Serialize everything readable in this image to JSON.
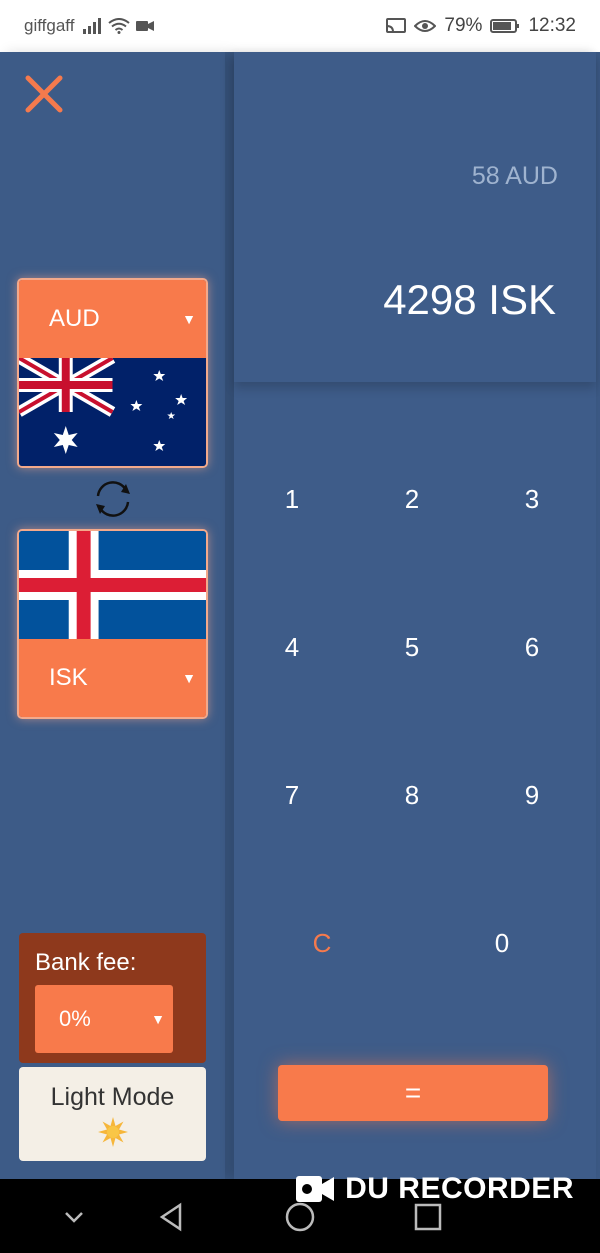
{
  "status_bar": {
    "carrier": "giffgaff",
    "battery": "79%",
    "time": "12:32"
  },
  "converter": {
    "from_currency": "AUD",
    "to_currency": "ISK",
    "input_display": "58 AUD",
    "result_display": "4298 ISK"
  },
  "keypad": {
    "keys": [
      "1",
      "2",
      "3",
      "4",
      "5",
      "6",
      "7",
      "8",
      "9",
      "C",
      "0"
    ],
    "equals_label": "="
  },
  "bank_fee": {
    "label": "Bank fee:",
    "value": "0%"
  },
  "mode_toggle": {
    "label": "Light Mode"
  },
  "watermark": {
    "text": "DU RECORDER"
  },
  "colors": {
    "accent": "#f87a4b",
    "background": "#3c5a86",
    "fee_background": "#8e391c",
    "clear_key": "#f57a4d"
  },
  "icons": {
    "close": "close-icon",
    "swap": "swap-icon",
    "sun": "sun-icon",
    "dropdown": "chevron-down-icon"
  }
}
